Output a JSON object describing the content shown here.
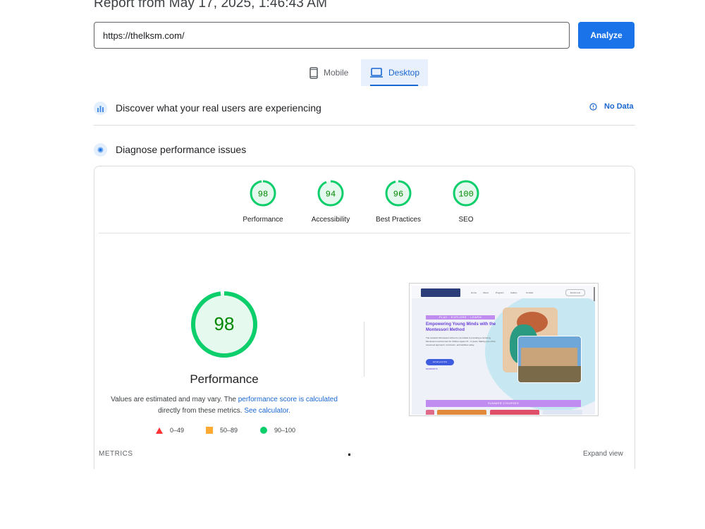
{
  "header": {
    "report_title": "Report from May 17, 2025, 1:46:43 AM"
  },
  "search": {
    "url_value": "https://thelksm.com/",
    "analyze_label": "Analyze"
  },
  "device_tabs": {
    "mobile": {
      "label": "Mobile",
      "icon": "phone-icon"
    },
    "desktop": {
      "label": "Desktop",
      "icon": "laptop-icon",
      "selected": true
    }
  },
  "field_data": {
    "title": "Discover what your real users are experiencing",
    "status": "No Data",
    "icon": "crux-users-icon",
    "status_icon": "info-icon"
  },
  "diagnose": {
    "title": "Diagnose performance issues",
    "icon": "lighthouse-icon"
  },
  "categories": [
    {
      "score": "98",
      "label": "Performance"
    },
    {
      "score": "94",
      "label": "Accessibility"
    },
    {
      "score": "96",
      "label": "Best Practices"
    },
    {
      "score": "100",
      "label": "SEO"
    }
  ],
  "performance": {
    "score": "98",
    "title": "Performance",
    "note_1": "Values are estimated and may vary. The",
    "note_link_1": "performance score is calculated",
    "note_2": "directly from these metrics.",
    "note_link_2": "See calculator."
  },
  "legend": [
    {
      "range": "0–49",
      "shape": "triangle",
      "color": "#ff3333"
    },
    {
      "range": "50–89",
      "shape": "square",
      "color": "#ffaa33"
    },
    {
      "range": "90–100",
      "shape": "circle",
      "color": "#0cce6b"
    }
  ],
  "colors": {
    "accent": "#1a73e8",
    "pass_green": "#0cce6b",
    "pass_text": "#008800",
    "pass_fill": "#e6f9ee"
  },
  "thumbnail": {
    "tagline": "PLAY · EXPLORE · LEARN",
    "headline": "Empowering Young Minds with the Montessori Method",
    "body": "The Lankesh Montessori school is committed to providing a nurturing, Montessori environment for children aged 2.5 – 6 years, Making use of the renowned approach, curriculum, and facilities today.",
    "button": "Enroll your Kid",
    "phone": "8208960076",
    "nav": [
      "Home",
      "About",
      "Program",
      "Gallery",
      "Contact"
    ],
    "enroll_label": "Enroll now",
    "section": "SUMMER COURSES"
  },
  "metrics": {
    "label": "METRICS",
    "expand_label": "Expand view"
  }
}
